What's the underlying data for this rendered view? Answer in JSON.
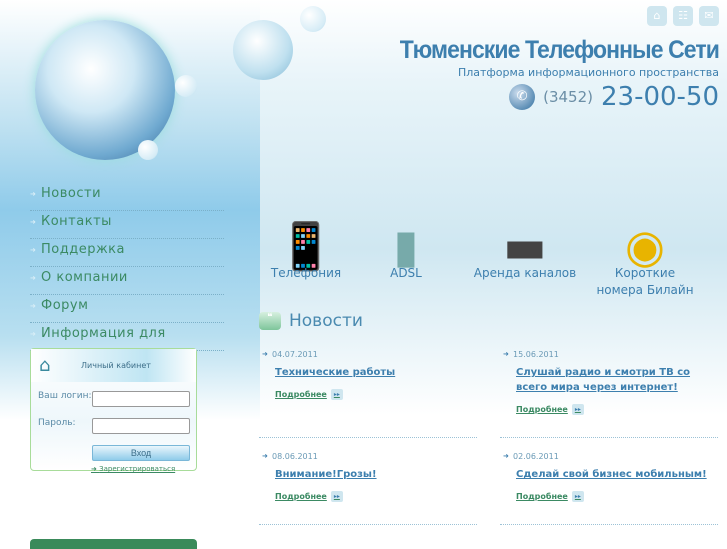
{
  "header": {
    "title": "Тюменские Телефонные Сети",
    "tagline": "Платформа информационного пространства",
    "phone_code": "(3452)",
    "phone_number": "23-00-50",
    "icons": [
      "home-icon",
      "sitemap-icon",
      "mail-icon"
    ]
  },
  "nav": [
    "Новости",
    "Контакты",
    "Поддержка",
    "О компании",
    "Форум",
    "Информация для акционеров"
  ],
  "login": {
    "title": "Личный кабинет",
    "login_label": "Ваш логин:",
    "password_label": "Пароль:",
    "login_value": "",
    "password_value": "",
    "submit": "Вход",
    "register": "Зарегистрироваться"
  },
  "services": [
    {
      "label": "Телефония"
    },
    {
      "label": "ADSL"
    },
    {
      "label": "Аренда каналов"
    },
    {
      "label": "Короткие номера Билайн"
    }
  ],
  "news": {
    "heading": "Новости",
    "more_label": "Подробнее",
    "items": [
      {
        "date": "04.07.2011",
        "title": "Технические работы"
      },
      {
        "date": "15.06.2011",
        "title": "Слушай радио и смотри ТВ со всего мира через интернет!"
      },
      {
        "date": "08.06.2011",
        "title": "Внимание!Грозы!"
      },
      {
        "date": "02.06.2011",
        "title": "Сделай свой бизнес мобильным!"
      }
    ]
  }
}
